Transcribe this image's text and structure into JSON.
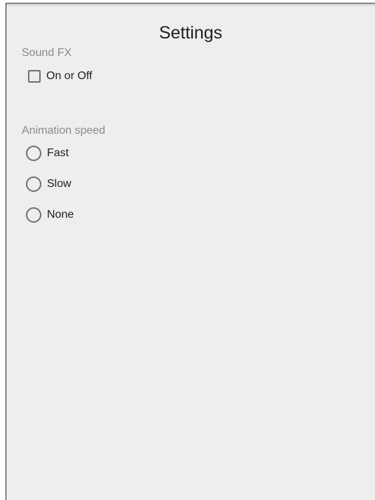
{
  "page": {
    "title": "Settings"
  },
  "sound_fx": {
    "label": "Sound FX",
    "checkbox": {
      "label": "On or Off",
      "checked": false
    }
  },
  "animation_speed": {
    "label": "Animation speed",
    "options": [
      {
        "label": "Fast",
        "selected": false
      },
      {
        "label": "Slow",
        "selected": false
      },
      {
        "label": "None",
        "selected": false
      }
    ]
  },
  "colors": {
    "background": "#eeeeee",
    "control_outline": "#6e6e6e",
    "section_label": "#8a8a8a",
    "text": "#212121"
  }
}
